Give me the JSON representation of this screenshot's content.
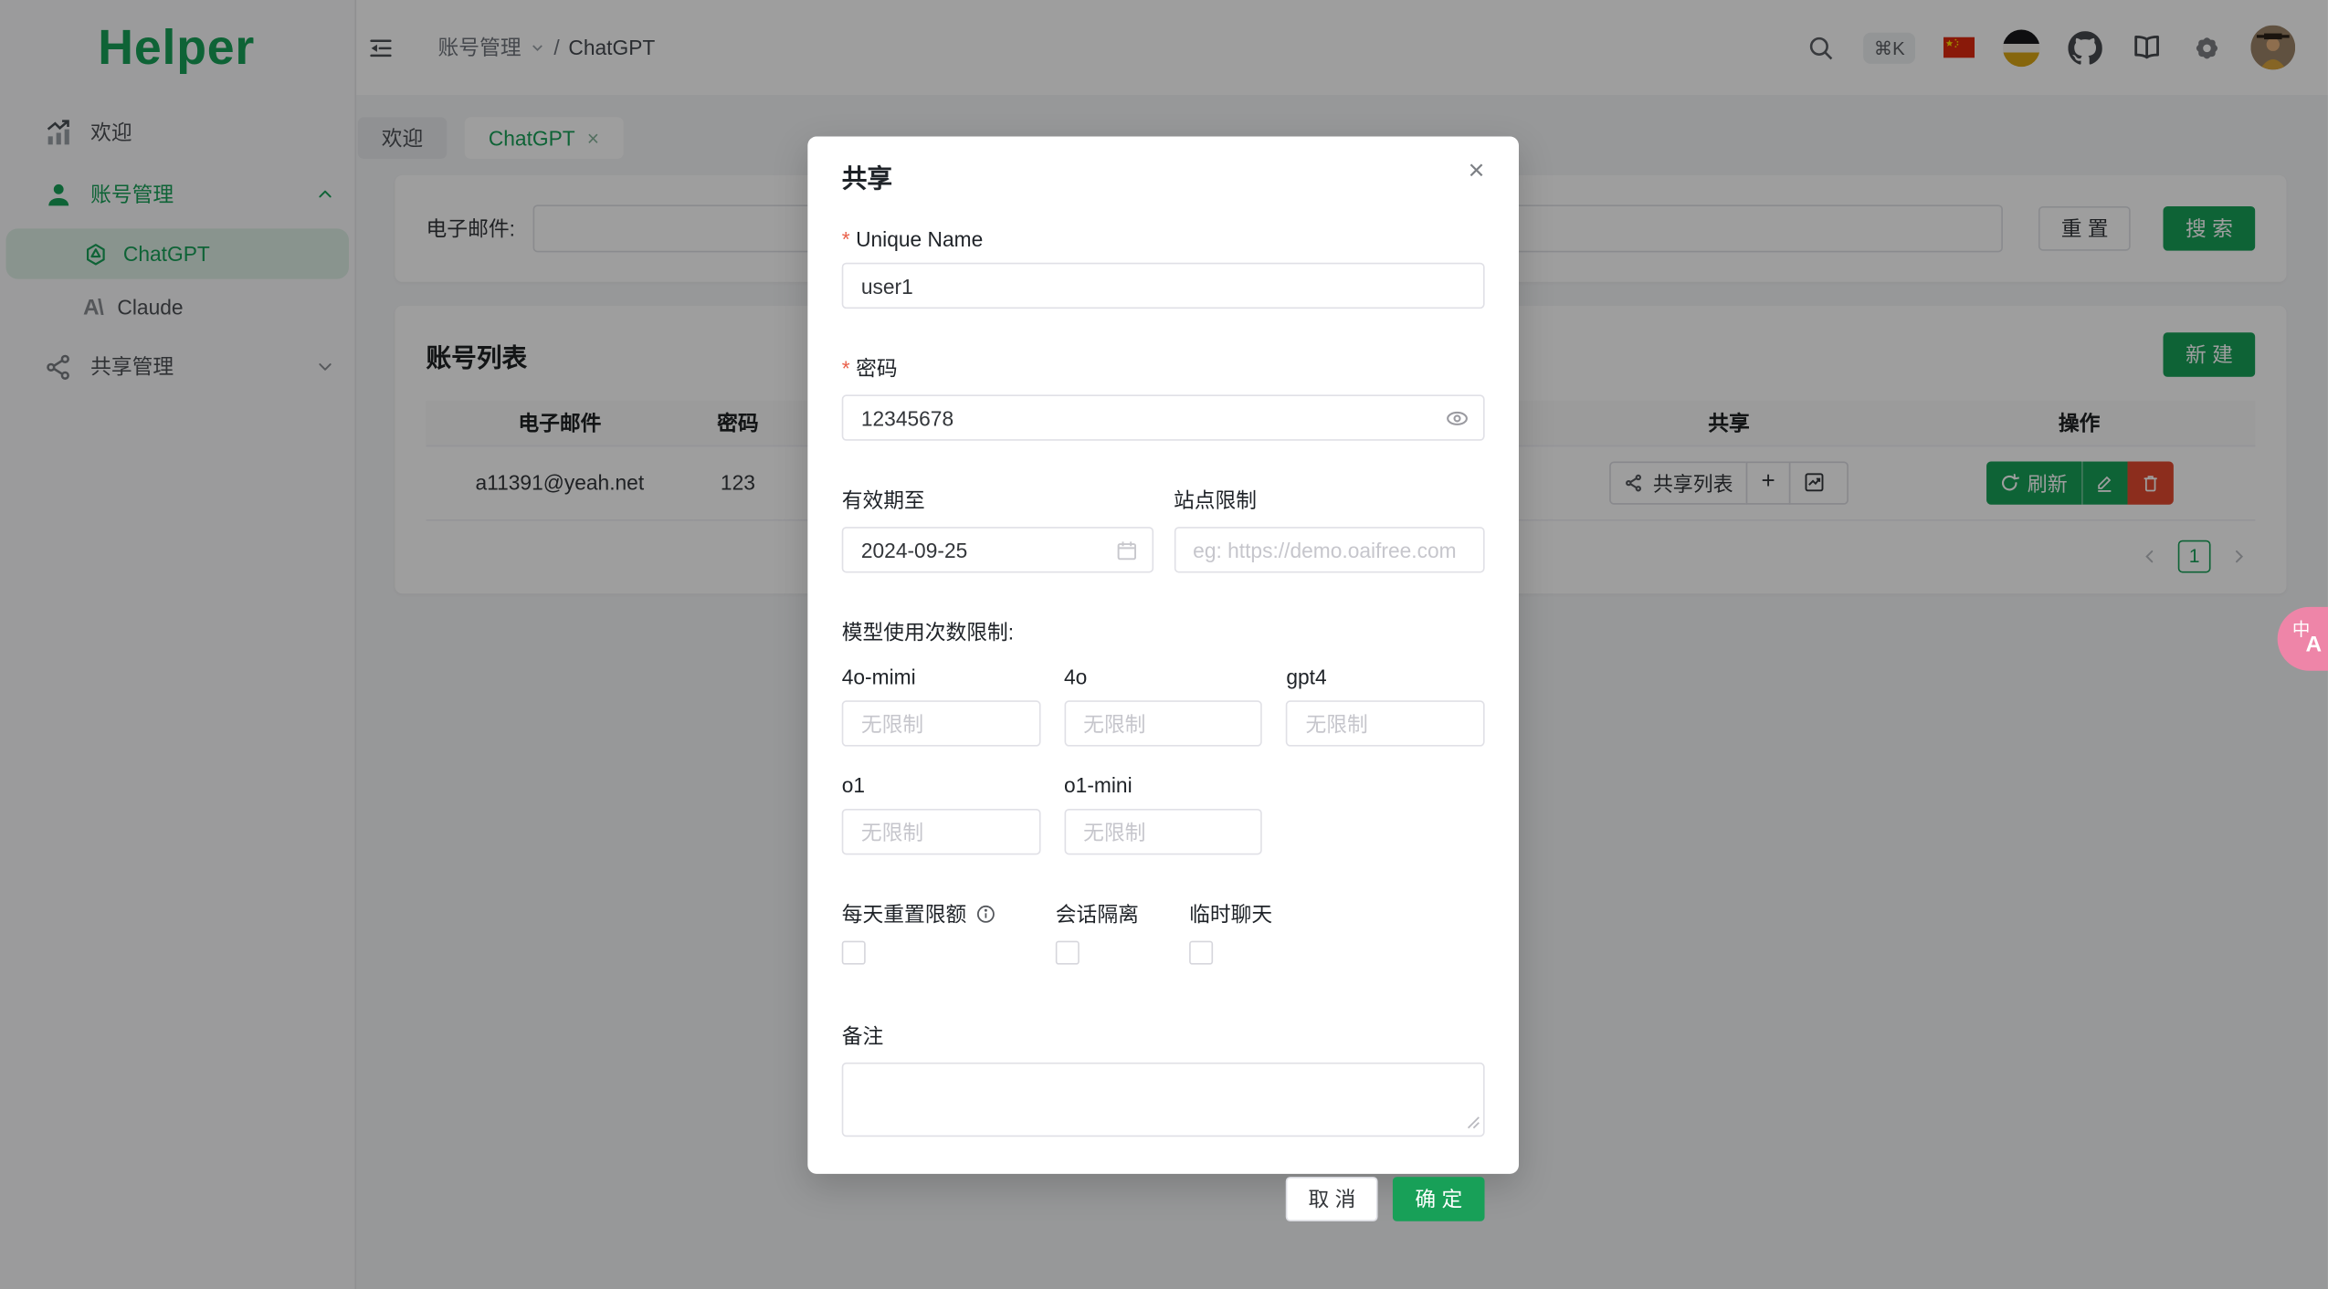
{
  "brand": {
    "logo": "Helper"
  },
  "colors": {
    "primary": "#18a058",
    "danger": "#e2492f",
    "selected_bg": "rgba(24,160,88,0.13)",
    "pill_pink": "#ee85a8"
  },
  "sidebar": {
    "items": [
      {
        "label": "欢迎",
        "icon": "chart-bars-icon",
        "active": false
      },
      {
        "label": "账号管理",
        "icon": "person-icon",
        "active": true,
        "expanded": true
      },
      {
        "label": "ChatGPT",
        "icon": "openai-logo-icon",
        "active": true,
        "selected": true
      },
      {
        "label": "Claude",
        "icon": "anthropic-logo-icon",
        "active": false
      },
      {
        "label": "共享管理",
        "icon": "share-nodes-icon",
        "active": false,
        "expanded": false
      }
    ]
  },
  "header": {
    "breadcrumb": {
      "section": "账号管理",
      "separator": "/",
      "page": "ChatGPT"
    },
    "shortcut": "⌘K",
    "icons": [
      "search-icon",
      "keyboard-shortcut-badge",
      "china-flag-icon",
      "striped-circle-icon",
      "github-icon",
      "book-icon",
      "gear-icon",
      "user-avatar"
    ]
  },
  "tabs": [
    {
      "label": "欢迎",
      "closable": false,
      "active": false
    },
    {
      "label": "ChatGPT",
      "closable": true,
      "active": true,
      "close_glyph": "×"
    }
  ],
  "filter": {
    "email_label": "电子邮件:",
    "email_value": "",
    "reset": "重 置",
    "search": "搜 索"
  },
  "list": {
    "title": "账号列表",
    "new": "新 建",
    "columns": [
      "电子邮件",
      "密码",
      "",
      "共享",
      "操作"
    ],
    "row": {
      "email": "a11391@yeah.net",
      "password": "123"
    },
    "share_list": "共享列表",
    "plus": "+",
    "refresh": "刷新",
    "page": "1"
  },
  "modal": {
    "title": "共享",
    "close_glyph": "×",
    "unique_name": {
      "label": "Unique Name",
      "value": "user1",
      "required": "*"
    },
    "password": {
      "label": "密码",
      "value": "12345678",
      "required": "*"
    },
    "valid_until": {
      "label": "有效期至",
      "value": "2024-09-25"
    },
    "site_limit": {
      "label": "站点限制",
      "placeholder": "eg: https://demo.oaifree.com"
    },
    "model_limit_label": "模型使用次数限制:",
    "models": [
      {
        "label": "4o-mimi",
        "placeholder": "无限制"
      },
      {
        "label": "4o",
        "placeholder": "无限制"
      },
      {
        "label": "gpt4",
        "placeholder": "无限制"
      },
      {
        "label": "o1",
        "placeholder": "无限制"
      },
      {
        "label": "o1-mini",
        "placeholder": "无限制"
      }
    ],
    "checkboxes": [
      {
        "label": "每天重置限额",
        "info": true,
        "checked": false
      },
      {
        "label": "会话隔离",
        "checked": false
      },
      {
        "label": "临时聊天",
        "checked": false
      }
    ],
    "remark_label": "备注",
    "remark_value": "",
    "cancel": "取 消",
    "confirm": "确 定"
  },
  "floating": {
    "translate_top": "中",
    "translate_bottom": "A"
  }
}
